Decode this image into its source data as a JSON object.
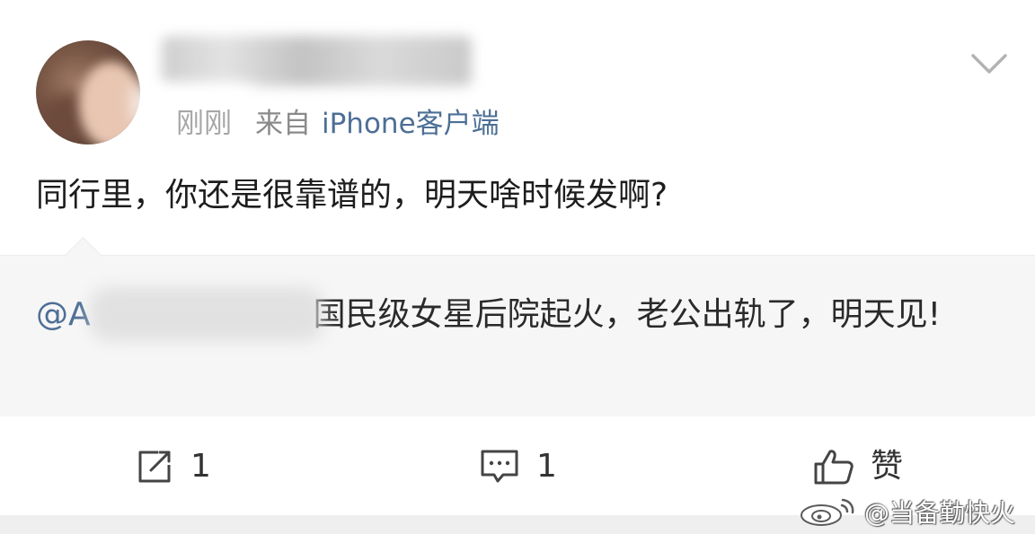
{
  "post": {
    "time": "刚刚",
    "source_prefix": "来自",
    "client": "iPhone客户端",
    "text": "同行里，你还是很靠谱的，明天啥时候发啊?"
  },
  "quoted": {
    "mention": "@A",
    "text": "国民级女星后院起火，老公出轨了，明天见!"
  },
  "actions": {
    "repost_count": "1",
    "comment_count": "1",
    "like_label": "赞"
  },
  "watermark": {
    "text": "@当备勤快火"
  },
  "colors": {
    "link": "#4d6f95",
    "quote_bg": "#f6f6f6",
    "meta_gray": "#8a8a8a"
  },
  "icons": [
    "expand-chevron-icon",
    "repost-icon",
    "comment-icon",
    "like-icon",
    "weibo-logo-icon"
  ]
}
